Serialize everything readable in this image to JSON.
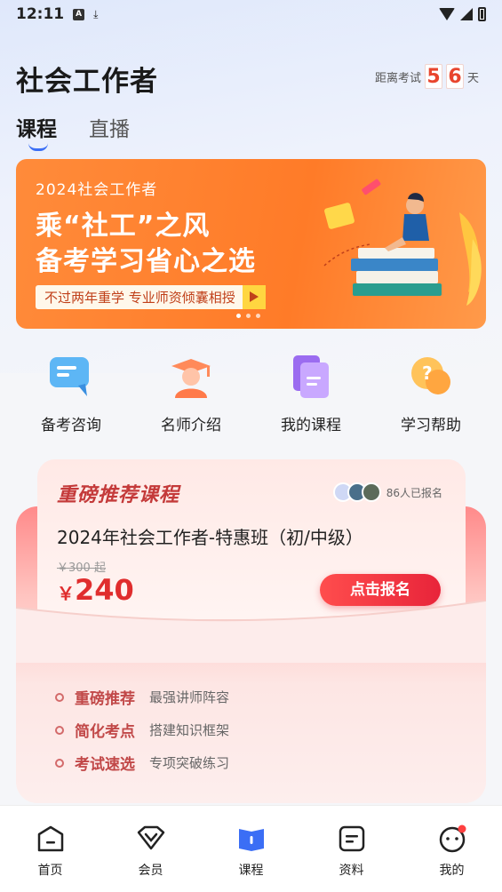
{
  "status": {
    "time": "12:11"
  },
  "header": {
    "title": "社会工作者",
    "countdown_prefix": "距离考试",
    "countdown_digits": [
      "5",
      "6"
    ],
    "countdown_suffix": "天"
  },
  "tabs": [
    {
      "label": "课程",
      "active": true
    },
    {
      "label": "直播",
      "active": false
    }
  ],
  "banner": {
    "year_line": "2024社会工作者",
    "headline_1": "乘“社工”之风",
    "headline_2": "备考学习省心之选",
    "tagline": "不过两年重学  专业师资倾囊相授"
  },
  "quick_links": [
    {
      "label": "备考咨询",
      "icon": "chat-bubble-icon"
    },
    {
      "label": "名师介绍",
      "icon": "teacher-icon"
    },
    {
      "label": "我的课程",
      "icon": "document-icon"
    },
    {
      "label": "学习帮助",
      "icon": "question-icon"
    }
  ],
  "recommend": {
    "title": "重磅推荐课程",
    "enrolled": "86人已报名",
    "course_name": "2024年社会工作者-特惠班（初/中级）",
    "old_price": "￥300 起",
    "currency": "￥",
    "price": "240",
    "buy_label": "点击报名",
    "features": [
      {
        "key": "重磅推荐",
        "value": "最强讲师阵容"
      },
      {
        "key": "简化考点",
        "value": "搭建知识框架"
      },
      {
        "key": "考试速选",
        "value": "专项突破练习"
      }
    ]
  },
  "nav": [
    {
      "label": "首页",
      "icon": "home-icon"
    },
    {
      "label": "会员",
      "icon": "vip-icon"
    },
    {
      "label": "课程",
      "icon": "course-book-icon",
      "active": true
    },
    {
      "label": "资料",
      "icon": "materials-icon"
    },
    {
      "label": "我的",
      "icon": "profile-icon"
    }
  ],
  "colors": {
    "accent": "#3b6ef5",
    "banner": "#ff7b28",
    "price": "#e02d2d"
  }
}
